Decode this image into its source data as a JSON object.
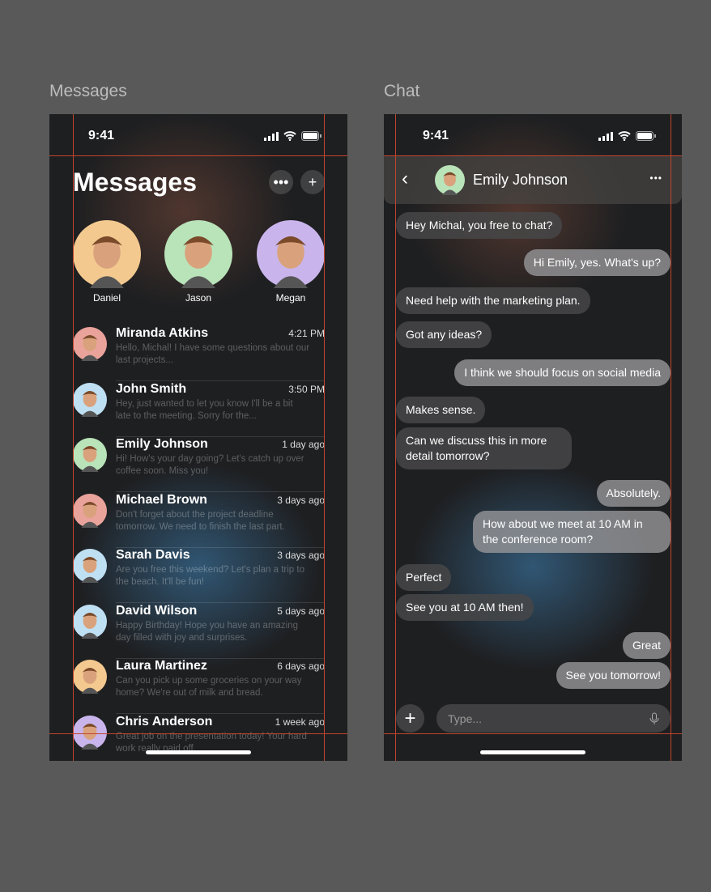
{
  "frames": {
    "messages": "Messages",
    "chat": "Chat"
  },
  "status": {
    "time": "9:41"
  },
  "messages": {
    "title": "Messages",
    "more_icon": "ellipsis",
    "add_icon": "plus",
    "stories": [
      {
        "name": "Daniel",
        "color": "#f3c98f"
      },
      {
        "name": "Jason",
        "color": "#b9e3b9"
      },
      {
        "name": "Megan",
        "color": "#c9b5ec"
      }
    ],
    "conversations": [
      {
        "name": "Miranda Atkins",
        "time": "4:21 PM",
        "preview": "Hello, Michal! I have some questions about our last projects...",
        "color": "#e9a39b"
      },
      {
        "name": "John Smith",
        "time": "3:50 PM",
        "preview": "Hey, just wanted to let you know I'll be a bit late to the meeting. Sorry for the...",
        "color": "#bfe0f3"
      },
      {
        "name": "Emily Johnson",
        "time": "1 day ago",
        "preview": "Hi! How's your day going? Let's catch up over coffee soon. Miss you!",
        "color": "#b9e3b9"
      },
      {
        "name": "Michael Brown",
        "time": "3 days ago",
        "preview": "Don't forget about the project deadline tomorrow. We need to finish the last part.",
        "color": "#e9a39b"
      },
      {
        "name": "Sarah Davis",
        "time": "3 days ago",
        "preview": "Are you free this weekend? Let's plan a trip to the beach. It'll be fun!",
        "color": "#bfe0f3"
      },
      {
        "name": "David Wilson",
        "time": "5 days ago",
        "preview": "Happy Birthday! Hope you have an amazing day filled with joy and surprises.",
        "color": "#bfe0f3"
      },
      {
        "name": "Laura Martinez",
        "time": "6 days ago",
        "preview": "Can you pick up some groceries on your way home? We're out of milk and bread.",
        "color": "#f3c98f"
      },
      {
        "name": "Chris Anderson",
        "time": "1 week ago",
        "preview": "Great job on the presentation today! Your hard work really paid off.",
        "color": "#c9b5ec"
      }
    ]
  },
  "chat": {
    "contact": "Emily Johnson",
    "avatar_color": "#b9e3b9",
    "messages": [
      {
        "dir": "in",
        "text": "Hey Michal, you free to chat?"
      },
      {
        "dir": "out",
        "text": "Hi Emily, yes. What's up?"
      },
      {
        "dir": "in",
        "text": "Need help with the marketing plan."
      },
      {
        "dir": "in",
        "text": "Got any ideas?"
      },
      {
        "dir": "out",
        "text": "I think we should focus on social media"
      },
      {
        "dir": "in",
        "text": "Makes sense."
      },
      {
        "dir": "in",
        "text": "Can we discuss this in more detail tomorrow?"
      },
      {
        "dir": "out",
        "text": "Absolutely."
      },
      {
        "dir": "out",
        "text": "How about we meet at 10 AM in the conference room?"
      },
      {
        "dir": "in",
        "text": "Perfect"
      },
      {
        "dir": "in",
        "text": "See you at 10 AM then!"
      },
      {
        "dir": "out",
        "text": "Great"
      },
      {
        "dir": "out",
        "text": "See you tomorrow!"
      }
    ],
    "input_placeholder": "Type..."
  }
}
